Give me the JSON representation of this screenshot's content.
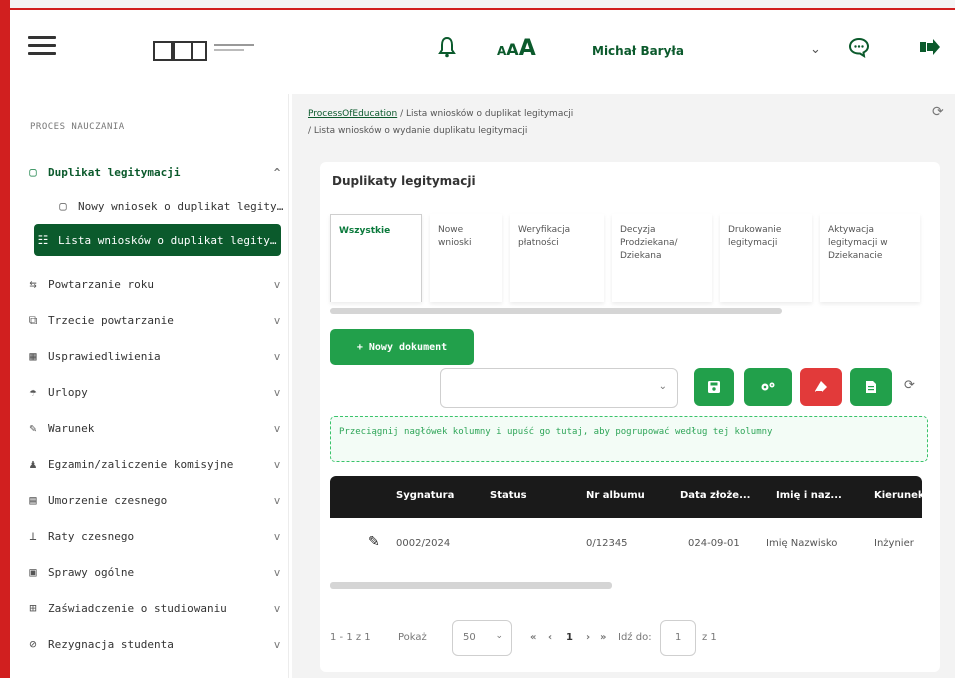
{
  "header": {
    "user_name": "Michał Baryła",
    "font_size_labels": [
      "A",
      "A",
      "A"
    ],
    "icons": [
      "menu-icon",
      "bell-icon",
      "chevron-down-icon",
      "chat-icon",
      "logout-icon"
    ]
  },
  "sidebar": {
    "section_title": "PROCES NAUCZANIA",
    "items": [
      {
        "label": "Duplikat legitymacji",
        "icon": "document-icon",
        "chevron": "^"
      },
      {
        "label": "Nowy wniosek o duplikat legitymacji",
        "icon": "document-icon"
      },
      {
        "label": "Lista wniosków o duplikat legitymacji",
        "icon": "list-icon"
      },
      {
        "label": "Powtarzanie roku",
        "icon": "repeat-icon",
        "chevron": "v"
      },
      {
        "label": "Trzecie powtarzanie",
        "icon": "sitemap-icon",
        "chevron": "v"
      },
      {
        "label": "Usprawiedliwienia",
        "icon": "calendar-icon",
        "chevron": "v"
      },
      {
        "label": "Urlopy",
        "icon": "umbrella-icon",
        "chevron": "v"
      },
      {
        "label": "Warunek",
        "icon": "edit-icon",
        "chevron": "v"
      },
      {
        "label": "Egzamin/zaliczenie komisyjne",
        "icon": "user-exam-icon",
        "chevron": "v"
      },
      {
        "label": "Umorzenie czesnego",
        "icon": "money-icon",
        "chevron": "v"
      },
      {
        "label": "Raty czesnego",
        "icon": "installments-icon",
        "chevron": "v"
      },
      {
        "label": "Sprawy ogólne",
        "icon": "folder-icon",
        "chevron": "v"
      },
      {
        "label": "Zaświadczenie o studiowaniu",
        "icon": "certificate-icon",
        "chevron": "v"
      },
      {
        "label": "Rezygnacja studenta",
        "icon": "cancel-icon",
        "chevron": "v"
      }
    ]
  },
  "breadcrumb": {
    "root": "ProcessOfEducation",
    "sep": "/",
    "level1": "Lista wniosków o duplikat legitymacji",
    "level2": "Lista wniosków o wydanie duplikatu legitymacji"
  },
  "card": {
    "title": "Duplikaty legitymacji",
    "tabs": [
      {
        "label": "Wszystkie",
        "active": true
      },
      {
        "label": "Nowe wnioski"
      },
      {
        "label": "Weryfikacja płatności"
      },
      {
        "label": "Decyzja Prodziekana/ Dziekana"
      },
      {
        "label": "Drukowanie legitymacji"
      },
      {
        "label": "Aktywacja legitymacji w Dziekanacie"
      }
    ],
    "new_button": "+ Nowy dokument",
    "select_value": "",
    "select_arrow": "⌄",
    "dropzone_text": "Przeciągnij nagłówek kolumny i upuść go tutaj, aby pogrupować według tej kolumny",
    "table": {
      "headers": [
        "Sygnatura",
        "Status",
        "Nr albumu",
        "Data złoże...",
        "Imię i naz...",
        "Kierunek"
      ],
      "rows": [
        {
          "sygnatura": "0002/2024",
          "status": "",
          "nr_albumu": "0/12345",
          "data": "024-09-01",
          "imie": "Imię Nazwisko",
          "kierunek": "Inżynier"
        }
      ]
    },
    "pager": {
      "range": "1 - 1 z 1",
      "per_page_label": "Pokaż",
      "per_page_value": "50",
      "first": "«",
      "prev": "‹",
      "page": "1",
      "next": "›",
      "last": "»",
      "goto_label": "Idź do:",
      "goto_value": "1",
      "of_label": "z 1"
    }
  },
  "colors": {
    "brand_dark": "#0b5a2c",
    "brand_green": "#22a04b",
    "danger": "#e23a3a",
    "frame_red": "#d11f1f"
  }
}
